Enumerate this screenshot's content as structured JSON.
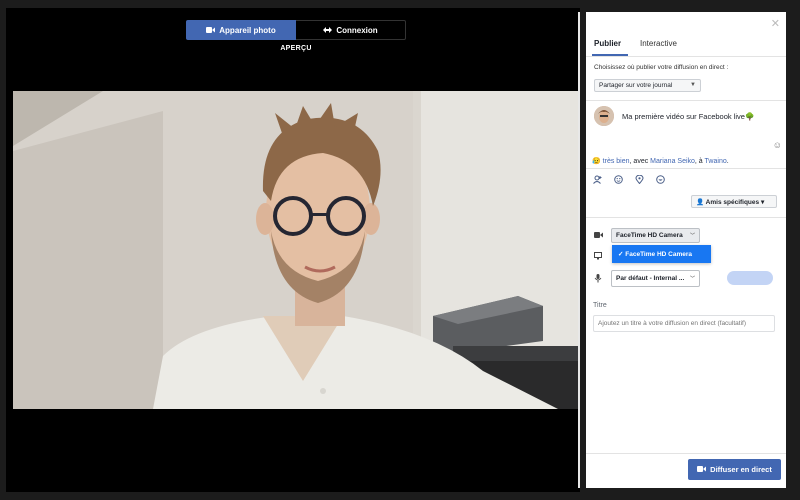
{
  "colors": {
    "accent": "#4267b2",
    "dropdown_highlight": "#1877f2",
    "background": "#000000"
  },
  "toggle": {
    "camera_label": "Appareil photo",
    "camera_icon": "video-camera-icon",
    "connect_label": "Connexion",
    "connect_icon": "connection-arrows-icon"
  },
  "preview_label": "APERÇU",
  "panel": {
    "tabs": [
      {
        "label": "Publier"
      },
      {
        "label": "Interactive"
      }
    ],
    "choose_label": "Choisissez où publier votre diffusion en direct :",
    "share_target": "Partager sur votre journal",
    "post_text": "Ma première vidéo sur Facebook live",
    "feeling": {
      "emoji": "😥",
      "label": "très bien",
      "with_text": ", avec",
      "friend": "Mariana Seiko",
      "at_text": ", à",
      "place": "Twaino",
      "end": "."
    },
    "audience_label": "Amis spécifiques",
    "camera_value": "FaceTime HD Camera",
    "camera_option_selected": "FaceTime HD Camera",
    "audio_value": "Par défaut - Internal ...",
    "title_label": "Titre",
    "title_placeholder": "Ajoutez un titre à votre diffusion en direct (facultatif)",
    "go_live_label": "Diffuser en direct"
  }
}
